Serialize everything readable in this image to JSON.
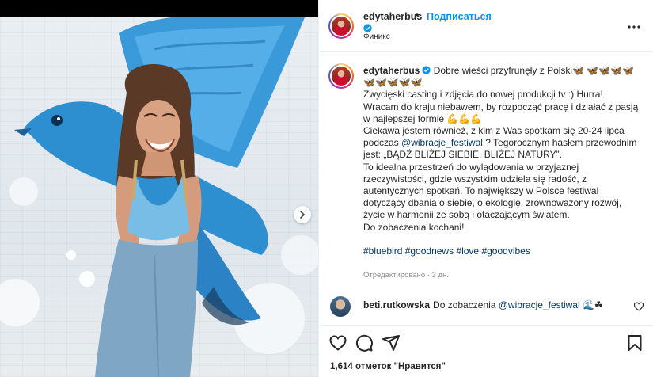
{
  "post": {
    "header": {
      "username": "edytaherbus",
      "separator": "•",
      "follow_label": "Подписаться",
      "location": "Финикс"
    },
    "caption": {
      "username": "edytaherbus",
      "line1": "Dobre wieści przyfrunęły z Polski🦋 🦋🦋🦋🦋",
      "line1b": "🦋🦋🦋🦋🦋",
      "p1": "Zwycięski casting i zdjęcia do nowej produkcji tv :) Hurra!",
      "p2": "Wracam do kraju niebawem, by rozpocząć pracę i działać z pasją w najlepszej formie 💪💪💪",
      "p3_before": "Ciekawa jestem również, z kim z Was spotkam się 20-24 lipca podczas ",
      "p3_mention": "@wibracje_festiwal",
      "p3_after": " ? Tegorocznym hasłem przewodnim jest: „BĄDŹ BLIŻEJ SIEBIE, BLIŻEJ NATURY”.",
      "p4": "To idealna przestrzeń do wylądowania w przyjaznej rzeczywistości, gdzie wszystkim udziela się radość, z autentycznych spotkań. To największy w Polsce festiwal dotyczący dbania o siebie, o ekologię, zrównoważony rozwój, życie w harmonii ze sobą i otaczającym światem.",
      "p5": "Do zobaczenia kochani!",
      "hashtags": "#bluebird #goodnews #love #goodvibes",
      "meta": "Отредактировано · 3 дн."
    },
    "comment": {
      "username": "beti.rutkowska",
      "text_before": "Do zobaczenia ",
      "mention": "@wibracje_festiwal",
      "text_after": " 🌊☘"
    },
    "likes_text": "1,614 отметок \"Нравится\""
  },
  "icons": {
    "verified": "verified-badge-icon",
    "more": "more-options-icon",
    "heart": "heart-icon",
    "comment": "comment-icon",
    "share": "share-icon",
    "save": "bookmark-icon",
    "carousel_next": "chevron-right-icon"
  },
  "colors": {
    "accent": "#0095f6",
    "link": "#00376b",
    "muted": "#8e8e8e",
    "bird_blue": "#2e8fd0"
  }
}
